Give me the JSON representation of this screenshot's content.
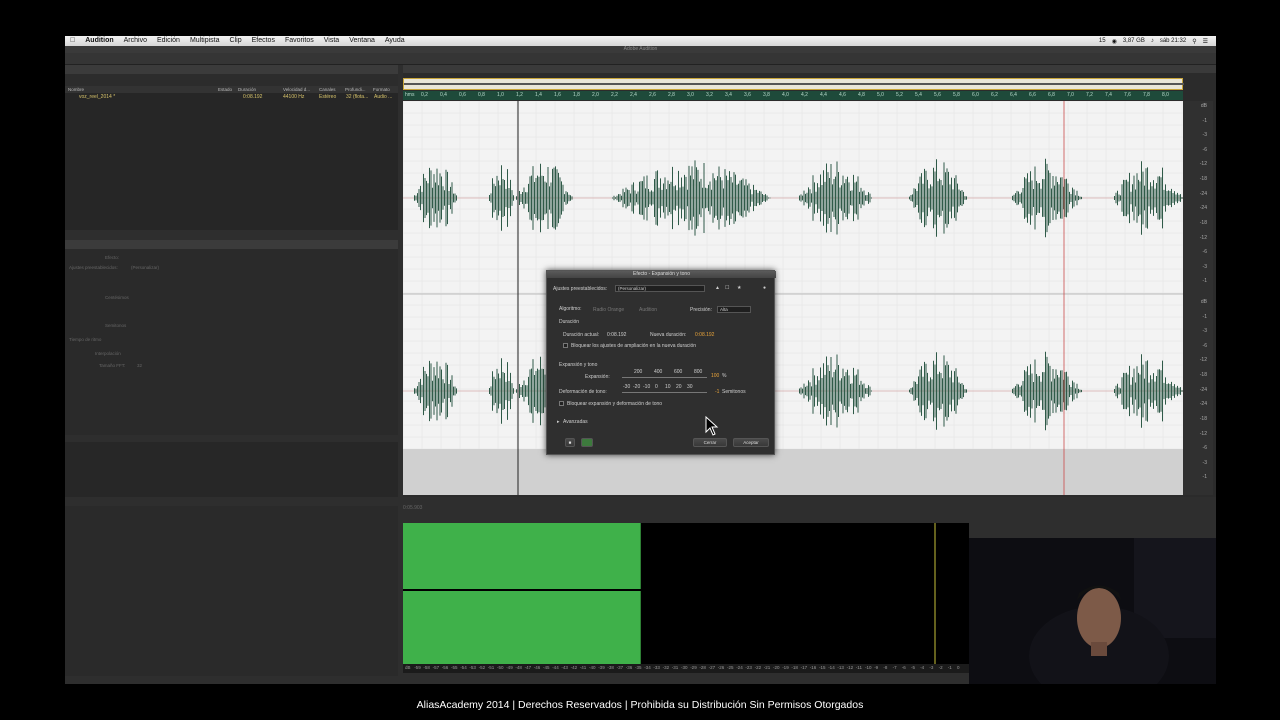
{
  "menubar": {
    "items": [
      "Audition",
      "Archivo",
      "Edición",
      "Multipista",
      "Clip",
      "Efectos",
      "Favoritos",
      "Vista",
      "Ventana",
      "Ayuda"
    ],
    "storage": "3,87 GB",
    "clock": "sáb 21:32",
    "battery": "15"
  },
  "window_title": "Adobe Audition",
  "files_panel": {
    "columns": [
      "Nombre",
      "Estado",
      "Duración",
      "Velocidad d...",
      "Canales",
      "Profundi...",
      "Formato"
    ],
    "row": {
      "name": "voz_reel_2014 *",
      "duration": "0:08.192",
      "rate": "44100 Hz",
      "channels": "Estéreo",
      "depth": "32 (flota...",
      "format": "Audio ..."
    }
  },
  "effects_panel": {
    "tabs": [
      "Expansión y tono"
    ],
    "labels": {
      "fx1": "Efecto:",
      "preset": "Ajustes preestablecidos:",
      "preset_value": "(Personalizar)",
      "cents_row": "Centésimos",
      "semitone_row": "Semitonos",
      "bpm": "Tiempo de ritmo",
      "pitch": "Interpolación",
      "fft": "Tamaño FFT:",
      "fft_value": "32"
    }
  },
  "editor": {
    "ruler_unit": "hms",
    "ruler_ticks": [
      "0,2",
      "0,4",
      "0,6",
      "0,8",
      "1,0",
      "1,2",
      "1,4",
      "1,6",
      "1,8",
      "2,0",
      "2,2",
      "2,4",
      "2,6",
      "2,8",
      "3,0",
      "3,2",
      "3,4",
      "3,6",
      "3,8",
      "4,0",
      "4,2",
      "4,4",
      "4,6",
      "4,8",
      "5,0",
      "5,2",
      "5,4",
      "5,6",
      "5,8",
      "6,0",
      "6,2",
      "6,4",
      "6,6",
      "6,8",
      "7,0",
      "7,2",
      "7,4",
      "7,6",
      "7,8",
      "8,0"
    ],
    "db_ticks_top": [
      "dB",
      "-1",
      "-3",
      "-6",
      "-12",
      "-18",
      "-24",
      "-24",
      "-18",
      "-12",
      "-6",
      "-3",
      "-1"
    ],
    "db_ticks_bottom": [
      "dB",
      "-1",
      "-3",
      "-6",
      "-12",
      "-18",
      "-24",
      "-24",
      "-18",
      "-12",
      "-6",
      "-3",
      "-1"
    ],
    "time_display": "0:05.903"
  },
  "dialog": {
    "title": "Efecto - Expansión y tono",
    "preset_label": "Ajustes preestablecidos:",
    "preset_value": "(Personalizar)",
    "algorithm_label": "Algoritmo:",
    "algorithm_opt1": "Radio Orange",
    "algorithm_opt2": "Audition",
    "precision_label": "Precisión:",
    "precision_value": "Alta",
    "duration_section": "Duración",
    "current_duration_label": "Duración actual:",
    "current_duration_value": "0:08.192",
    "new_duration_label": "Nueva duración:",
    "new_duration_value": "0:08.192",
    "lock_duration_label": "Bloquear los ajustes de ampliación en la nueva duración",
    "stretch_section": "Expansión y tono",
    "stretch_label": "Expansión:",
    "stretch_ticks": [
      "200",
      "400",
      "600",
      "800"
    ],
    "stretch_value": "100",
    "stretch_unit": "%",
    "pitch_label": "Deformación de tono:",
    "pitch_ticks": [
      "-30",
      "-20",
      "-10",
      "0",
      "10",
      "20",
      "30"
    ],
    "pitch_value": "-1",
    "pitch_unit": "Semitonos",
    "lock_pitch_label": "Bloquear expansión y deformación de tono",
    "advanced_label": "Avanzadas",
    "close_button": "Cerrar",
    "ok_button": "Aceptar"
  },
  "meters": {
    "scale": [
      "dB",
      "-59",
      "-58",
      "-57",
      "-56",
      "-55",
      "-54",
      "-53",
      "-52",
      "-51",
      "-50",
      "-49",
      "-48",
      "-47",
      "-46",
      "-45",
      "-44",
      "-43",
      "-42",
      "-41",
      "-40",
      "-39",
      "-38",
      "-37",
      "-36",
      "-35",
      "-34",
      "-33",
      "-32",
      "-31",
      "-30",
      "-29",
      "-28",
      "-27",
      "-26",
      "-25",
      "-24",
      "-23",
      "-22",
      "-21",
      "-20",
      "-19",
      "-18",
      "-17",
      "-16",
      "-15",
      "-14",
      "-13",
      "-12",
      "-11",
      "-10",
      "-9",
      "-8",
      "-7",
      "-6",
      "-5",
      "-4",
      "-3",
      "-2",
      "-1",
      "0"
    ],
    "level_fraction": 0.42
  },
  "caption": "AliasAcademy 2014 | Derechos Reservados | Prohibida su Distribución Sin Permisos Otorgados",
  "colors": {
    "waveform": "#2f5a48",
    "ruler": "#1e4a3a",
    "meter": "#3fb14a",
    "accent": "#e8a33a",
    "playhead": "#c94a4a"
  }
}
